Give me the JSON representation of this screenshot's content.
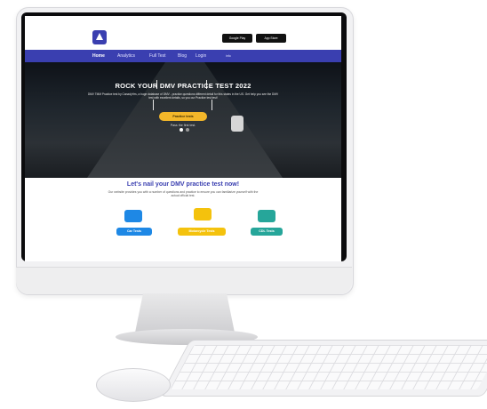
{
  "header": {
    "store_badges": [
      "Google Play",
      "App Store"
    ]
  },
  "nav": {
    "items": [
      "Home",
      "Analytics",
      "Full Test",
      "Blog",
      "Login"
    ],
    "small_label": "info"
  },
  "hero": {
    "title": "ROCK YOUR DMV PRACTICE TEST 2022",
    "description": "DMV TMM Practice test by CanadyYes, a huge database of DMV - practice questions different detail for this states in the US. Get help you see the DMV test with excellent details, so you our Practice test test!",
    "button_label": "Practice tests",
    "note": "Pass the first test.",
    "slide_dots": 2
  },
  "intro": {
    "tagline": "Let's nail your DMV practice test now!",
    "subtext": "Our website provides you with a number of questions and practice to ensure you can familiarize yourself with the actual official test."
  },
  "cards": [
    {
      "label": "Car Tests",
      "icon": "car-icon",
      "color": "#1e88e5"
    },
    {
      "label": "Motorcycle Tests",
      "icon": "motorcycle-icon",
      "color": "#f4c20d"
    },
    {
      "label": "CDL Tests",
      "icon": "truck-icon",
      "color": "#26a69a"
    }
  ],
  "colors": {
    "brand": "#3a3fb0",
    "accent": "#f3b72a"
  }
}
